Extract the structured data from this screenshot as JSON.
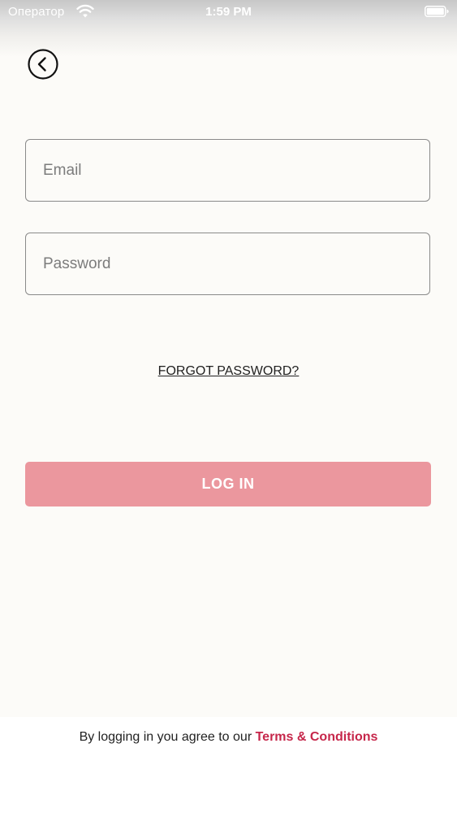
{
  "status_bar": {
    "carrier": "Оператор",
    "time": "1:59 PM",
    "wifi_icon": "wifi-icon",
    "battery_icon": "battery-icon"
  },
  "back_button": {
    "icon": "chevron-left-icon"
  },
  "form": {
    "email_placeholder": "Email",
    "email_value": "",
    "password_placeholder": "Password",
    "password_value": "",
    "forgot_password_label": "FORGOT PASSWORD?",
    "login_label": "LOG IN"
  },
  "footer": {
    "terms_prefix": "By logging in you agree to our ",
    "terms_link": "Terms & Conditions"
  },
  "colors": {
    "background": "#fcfbf8",
    "login_button": "#eb979e",
    "terms_link": "#c6264a",
    "field_border": "#8a8a8a"
  }
}
